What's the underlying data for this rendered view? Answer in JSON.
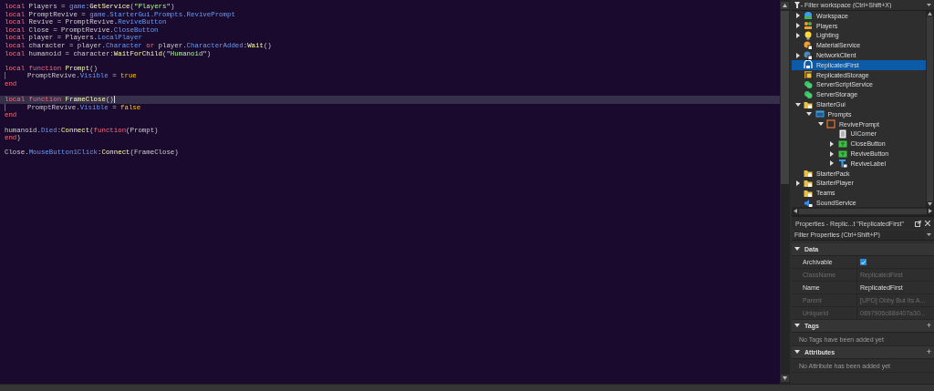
{
  "editor": {
    "lines": [
      {
        "tokens": [
          {
            "kind": "keyword",
            "text": "local"
          },
          {
            "kind": "plain",
            "text": " Players = "
          },
          {
            "kind": "member",
            "text": "game"
          },
          {
            "kind": "plain",
            "text": ":"
          },
          {
            "kind": "method",
            "text": "GetService"
          },
          {
            "kind": "plain",
            "text": "("
          },
          {
            "kind": "string",
            "text": "\"Players\""
          },
          {
            "kind": "plain",
            "text": ")"
          }
        ]
      },
      {
        "tokens": [
          {
            "kind": "keyword",
            "text": "local"
          },
          {
            "kind": "plain",
            "text": " PromptRevive = "
          },
          {
            "kind": "member",
            "text": "game.StarterGui.Prompts.RevivePrompt"
          }
        ]
      },
      {
        "tokens": [
          {
            "kind": "keyword",
            "text": "local"
          },
          {
            "kind": "plain",
            "text": " Revive = PromptRevive."
          },
          {
            "kind": "member",
            "text": "ReviveButton"
          }
        ]
      },
      {
        "tokens": [
          {
            "kind": "keyword",
            "text": "local"
          },
          {
            "kind": "plain",
            "text": " Close = PromptRevive."
          },
          {
            "kind": "member",
            "text": "CloseButton"
          }
        ]
      },
      {
        "tokens": [
          {
            "kind": "keyword",
            "text": "local"
          },
          {
            "kind": "plain",
            "text": " player = Players."
          },
          {
            "kind": "member",
            "text": "LocalPlayer"
          }
        ]
      },
      {
        "tokens": [
          {
            "kind": "keyword",
            "text": "local"
          },
          {
            "kind": "plain",
            "text": " character = player."
          },
          {
            "kind": "member",
            "text": "Character"
          },
          {
            "kind": "keyword",
            "text": " or"
          },
          {
            "kind": "plain",
            "text": " player."
          },
          {
            "kind": "member",
            "text": "CharacterAdded"
          },
          {
            "kind": "plain",
            "text": ":"
          },
          {
            "kind": "method",
            "text": "Wait"
          },
          {
            "kind": "plain",
            "text": "()"
          }
        ]
      },
      {
        "tokens": [
          {
            "kind": "keyword",
            "text": "local"
          },
          {
            "kind": "plain",
            "text": " humanoid = character:"
          },
          {
            "kind": "method",
            "text": "WaitForChild"
          },
          {
            "kind": "plain",
            "text": "("
          },
          {
            "kind": "string",
            "text": "\"Humanoid\""
          },
          {
            "kind": "plain",
            "text": ")"
          }
        ]
      },
      {
        "gap_before": true,
        "tokens": [
          {
            "kind": "keyword",
            "text": "local function"
          },
          {
            "kind": "method",
            "text": " Prompt"
          },
          {
            "kind": "plain",
            "text": "()"
          }
        ]
      },
      {
        "indent": true,
        "tokens": [
          {
            "kind": "plain",
            "text": "PromptRevive."
          },
          {
            "kind": "member",
            "text": "Visible"
          },
          {
            "kind": "plain",
            "text": " = "
          },
          {
            "kind": "bool",
            "text": "true"
          }
        ]
      },
      {
        "tokens": [
          {
            "kind": "keyword",
            "text": "end"
          }
        ]
      },
      {
        "gap_before": true,
        "current": true,
        "tokens": [
          {
            "kind": "keyword",
            "text": "local function"
          },
          {
            "kind": "method",
            "text": " FrameClose"
          },
          {
            "kind": "plain",
            "text": "()"
          }
        ]
      },
      {
        "indent": true,
        "tokens": [
          {
            "kind": "plain",
            "text": "PromptRevive."
          },
          {
            "kind": "member",
            "text": "Visible"
          },
          {
            "kind": "plain",
            "text": " = "
          },
          {
            "kind": "bool",
            "text": "false"
          }
        ]
      },
      {
        "tokens": [
          {
            "kind": "keyword",
            "text": "end"
          }
        ]
      },
      {
        "gap_before": true,
        "tokens": [
          {
            "kind": "plain",
            "text": "humanoid."
          },
          {
            "kind": "member",
            "text": "Died"
          },
          {
            "kind": "plain",
            "text": ":"
          },
          {
            "kind": "method",
            "text": "Connect"
          },
          {
            "kind": "plain",
            "text": "("
          },
          {
            "kind": "keyword",
            "text": "function"
          },
          {
            "kind": "plain",
            "text": "(Prompt)"
          }
        ]
      },
      {
        "tokens": [
          {
            "kind": "keyword",
            "text": "end"
          },
          {
            "kind": "plain",
            "text": ")"
          }
        ]
      },
      {
        "gap_before": true,
        "tokens": [
          {
            "kind": "plain",
            "text": "Close."
          },
          {
            "kind": "member",
            "text": "MouseButton1Click"
          },
          {
            "kind": "plain",
            "text": ":"
          },
          {
            "kind": "method",
            "text": "Connect"
          },
          {
            "kind": "plain",
            "text": "(FrameClose)"
          }
        ]
      }
    ]
  },
  "explorer": {
    "filter": {
      "placeholder": "Filter workspace (Ctrl+Shift+X)"
    },
    "items": [
      {
        "label": "Workspace",
        "kind": "workspace",
        "expanded": false,
        "selected": false
      },
      {
        "label": "Players",
        "kind": "players",
        "expanded": false,
        "selected": false
      },
      {
        "label": "Lighting",
        "kind": "lighting",
        "expanded": false,
        "selected": false
      },
      {
        "label": "MaterialService",
        "kind": "service",
        "selected": false
      },
      {
        "label": "NetworkClient",
        "kind": "network",
        "expanded": false,
        "selected": false
      },
      {
        "label": "ReplicatedFirst",
        "kind": "replicated",
        "selected": true
      },
      {
        "label": "ReplicatedStorage",
        "kind": "storage",
        "selected": false
      },
      {
        "label": "ServerScriptService",
        "kind": "server",
        "selected": false
      },
      {
        "label": "ServerStorage",
        "kind": "server",
        "selected": false
      },
      {
        "label": "StarterGui",
        "kind": "folder",
        "expanded": true,
        "selected": false,
        "children": [
          {
            "label": "Prompts",
            "kind": "screen",
            "expanded": true,
            "selected": false,
            "children": [
              {
                "label": "RevivePrompt",
                "kind": "frame",
                "expanded": true,
                "selected": false,
                "children": [
                  {
                    "label": "UICorner",
                    "kind": "doc",
                    "selected": false
                  },
                  {
                    "label": "CloseButton",
                    "kind": "button",
                    "expanded": false,
                    "selected": false
                  },
                  {
                    "label": "ReviveButton",
                    "kind": "button",
                    "expanded": false,
                    "selected": false
                  },
                  {
                    "label": "ReviveLabel",
                    "kind": "label",
                    "expanded": false,
                    "selected": false
                  }
                ]
              }
            ]
          }
        ]
      },
      {
        "label": "StarterPack",
        "kind": "folder",
        "selected": false
      },
      {
        "label": "StarterPlayer",
        "kind": "folder",
        "expanded": false,
        "selected": false
      },
      {
        "label": "Teams",
        "kind": "folder",
        "selected": false
      },
      {
        "label": "SoundService",
        "kind": "sound",
        "selected": false
      }
    ]
  },
  "properties": {
    "title": "Properties - Replic...t \"ReplicatedFirst\"",
    "filter": {
      "placeholder": "Filter Properties (Ctrl+Shift+P)"
    },
    "sections": [
      {
        "title": "Data",
        "expanded": true,
        "rows": [
          {
            "name": "Archivable",
            "kind": "checkbox",
            "checked": true,
            "disabled": false
          },
          {
            "name": "ClassName",
            "kind": "text",
            "value": "ReplicatedFirst",
            "disabled": true
          },
          {
            "name": "Name",
            "kind": "text",
            "value": "ReplicatedFirst",
            "disabled": false
          },
          {
            "name": "Parent",
            "kind": "text",
            "value": "[UPD] Obby But Its A...",
            "disabled": true
          },
          {
            "name": "UniqueId",
            "kind": "text",
            "value": "0897906c88d407a30...",
            "disabled": true
          }
        ]
      },
      {
        "title": "Tags",
        "expanded": true,
        "add_label": "+",
        "empty": "No Tags have been added yet"
      },
      {
        "title": "Attributes",
        "expanded": true,
        "add_label": "+",
        "empty": "No Attribute has been added yet"
      }
    ]
  }
}
